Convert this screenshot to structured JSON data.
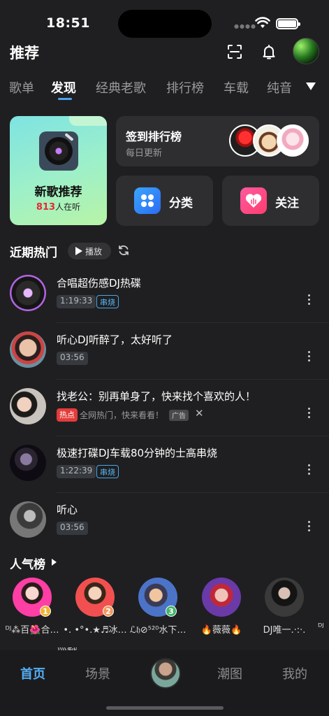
{
  "status_bar": {
    "time": "18:51"
  },
  "header": {
    "title": "推荐"
  },
  "tabs": [
    "歌单",
    "发现",
    "经典老歌",
    "排行榜",
    "车载",
    "纯音"
  ],
  "cards": {
    "new_songs": {
      "title": "新歌推荐",
      "count": "813",
      "count_suffix": "人在听"
    },
    "checkin": {
      "title": "签到排行榜",
      "subtitle": "每日更新"
    },
    "category": {
      "label": "分类"
    },
    "follow": {
      "label": "关注"
    }
  },
  "recent": {
    "title": "近期热门",
    "play_label": "播放"
  },
  "songs": [
    {
      "title": "合唱超伤感DJ热碟",
      "duration": "1:19:33",
      "tag": "串烧"
    },
    {
      "title": "听心DJ听醉了，太好听了",
      "duration": "03:56"
    },
    {
      "title": "找老公：别再单身了，快来找个喜欢的人！",
      "hot": "热点",
      "sub": "全网热门，快来看看！",
      "ad": "广告",
      "close": "✕"
    },
    {
      "title": "极速打碟DJ车载80分钟的士高串烧",
      "duration": "1:22:39",
      "tag": "串烧"
    },
    {
      "title": "听心",
      "duration": "03:56"
    }
  ],
  "popular": {
    "title": "人气榜"
  },
  "singers": [
    {
      "name": "ᴰᴶ⁂百🌺合…",
      "rank": "1",
      "color": "#f2b431"
    },
    {
      "name": "•. •°•.★♬冰…",
      "rank": "2",
      "color": "#f29a5b"
    },
    {
      "name": "ℒ𝔥⊘⁵²⁰水下…",
      "rank": "3",
      "color": "#43b56a"
    },
    {
      "name": "🔥薇薇🔥"
    },
    {
      "name": "DJ唯一.·:·."
    },
    {
      "name": "ᴰᴶ"
    }
  ],
  "peek_text": "巡疑",
  "tabbar": [
    "首页",
    "场景",
    "潮图",
    "我的"
  ]
}
